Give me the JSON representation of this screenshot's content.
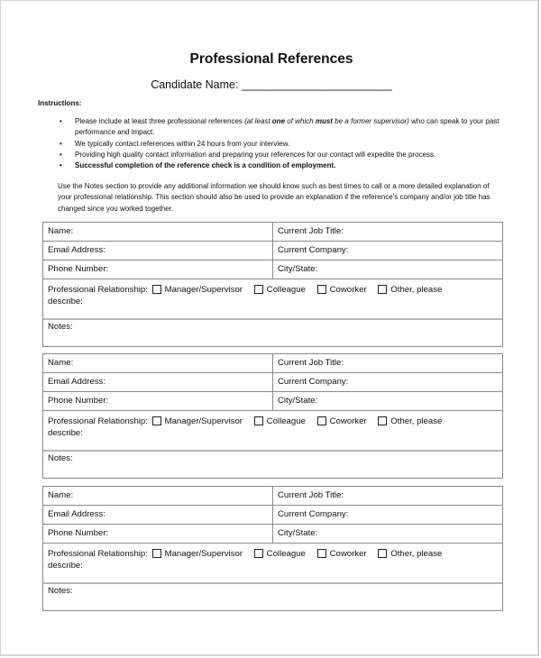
{
  "document": {
    "title": "Professional References",
    "candidate_label": "Candidate Name: ________________________",
    "instructions_label": "Instructions:",
    "bullets": [
      {
        "pre": "Please include at least three professional references ",
        "italic_a": "(at least ",
        "bold_italic_a": "one",
        "italic_b": " of which ",
        "bold_italic_b": "must",
        "italic_c": " be a former supervisor)",
        "post": " who can speak to your past performance and impact."
      },
      {
        "text": "We typically contact references within 24 hours from your interview."
      },
      {
        "text": "Providing high quality contact information and preparing your references for our contact will expedite the process."
      },
      {
        "text": "Successful completion of the reference check is a condition of employment."
      }
    ],
    "notes_paragraph": "Use the Notes section to provide any additional information we should know such as best times to call or a more detailed explanation of your professional relationship. This section should also be used to provide an explanation if the reference’s company and/or job title has changed since you worked together."
  },
  "form": {
    "name_label": "Name:",
    "job_title_label": "Current Job Title:",
    "email_label": "Email Address:",
    "company_label": "Current Company:",
    "phone_label": "Phone Number:",
    "city_state_label": "City/State:",
    "relationship_label": "Professional Relationship:",
    "relationship_options": [
      "Manager/Supervisor",
      "Colleague",
      "Coworker",
      "Other, please"
    ],
    "describe_label": "describe:",
    "notes_label": "Notes:",
    "bullet_glyph": "•"
  },
  "reference_blocks": [
    {
      "index": 1
    },
    {
      "index": 2
    },
    {
      "index": 3
    }
  ]
}
